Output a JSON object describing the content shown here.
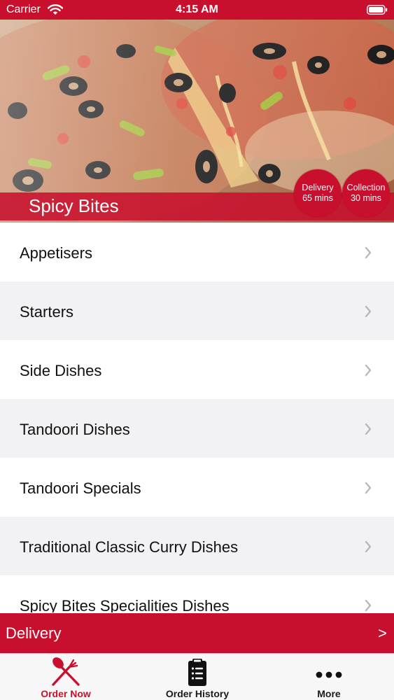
{
  "status_bar": {
    "carrier": "Carrier",
    "time": "4:15 AM",
    "wifi_icon": "wifi-icon",
    "battery_icon": "battery-icon"
  },
  "hero": {
    "restaurant_name": "Spicy Bites",
    "image": "pizza-photo",
    "delivery_badge": {
      "label": "Delivery",
      "time": "65 mins"
    },
    "collection_badge": {
      "label": "Collection",
      "time": "30 mins"
    }
  },
  "menu": {
    "categories": [
      "Appetisers",
      "Starters",
      "Side Dishes",
      "Tandoori Dishes",
      "Tandoori Specials",
      "Traditional Classic Curry Dishes",
      "Spicy Bites Specialities Dishes"
    ],
    "chevron_icon": "chevron-right-icon"
  },
  "order_mode": {
    "label": "Delivery",
    "arrow": ">"
  },
  "tab_bar": {
    "tabs": [
      {
        "label": "Order Now",
        "icon": "fork-knife-icon",
        "active": true
      },
      {
        "label": "Order History",
        "icon": "clipboard-list-icon",
        "active": false
      },
      {
        "label": "More",
        "icon": "more-dots-icon",
        "active": false
      }
    ]
  },
  "colors": {
    "brand_red": "#c8102e",
    "row_alt": "#f2f2f4",
    "tab_bar_bg": "#f7f7f7"
  }
}
